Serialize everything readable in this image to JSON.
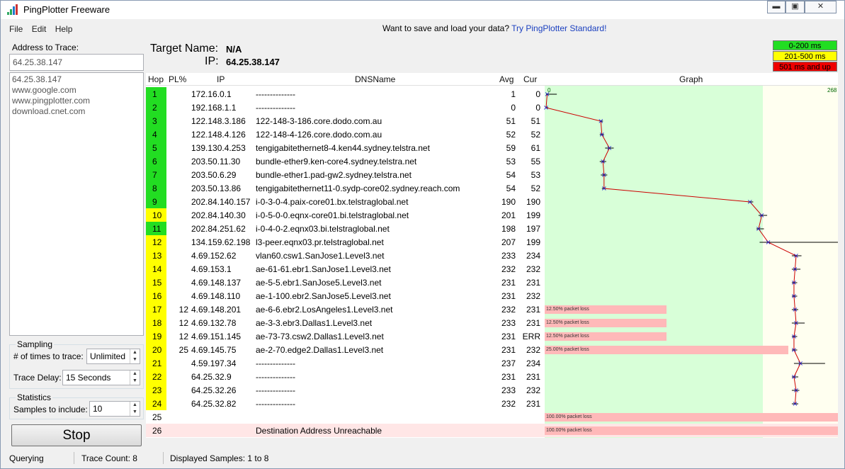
{
  "window": {
    "title": "PingPlotter Freeware"
  },
  "menu": [
    "File",
    "Edit",
    "Help"
  ],
  "promo": {
    "text": "Want to save and load your data?",
    "link": "Try PingPlotter Standard!"
  },
  "address": {
    "label": "Address to Trace:",
    "value": "64.25.38.147",
    "history": [
      "64.25.38.147",
      "www.google.com",
      "www.pingplotter.com",
      "download.cnet.com"
    ]
  },
  "sampling": {
    "title": "Sampling",
    "times_label": "# of times to trace:",
    "times_value": "Unlimited",
    "delay_label": "Trace Delay:",
    "delay_value": "15 Seconds"
  },
  "statistics": {
    "title": "Statistics",
    "samples_label": "Samples to include:",
    "samples_value": "10"
  },
  "stop_button": "Stop",
  "target": {
    "name_label": "Target Name:",
    "name_value": "N/A",
    "ip_label": "IP:",
    "ip_value": "64.25.38.147"
  },
  "legend": [
    {
      "label": "0-200 ms",
      "color": "#22dd22"
    },
    {
      "label": "201-500 ms",
      "color": "#ffff00"
    },
    {
      "label": "501 ms and up",
      "color": "#ee0000"
    }
  ],
  "columns": {
    "hop": "Hop",
    "pl": "PL%",
    "ip": "IP",
    "dns": "DNSName",
    "avg": "Avg",
    "cur": "Cur",
    "graph": "Graph"
  },
  "graph_scale": {
    "min_label": "0",
    "max_label": "268",
    "max": 268
  },
  "hops": [
    {
      "hop": "1",
      "pl": "",
      "ip": "172.16.0.1",
      "dns": "--------------",
      "avg": "1",
      "cur": "0",
      "color": "green",
      "err": [
        0,
        10
      ]
    },
    {
      "hop": "2",
      "pl": "",
      "ip": "192.168.1.1",
      "dns": "--------------",
      "avg": "0",
      "cur": "0",
      "color": "green",
      "err": [
        0,
        2
      ]
    },
    {
      "hop": "3",
      "pl": "",
      "ip": "122.148.3.186",
      "dns": "122-148-3-186.core.dodo.com.au",
      "avg": "51",
      "cur": "51",
      "color": "green",
      "err": [
        50,
        53
      ]
    },
    {
      "hop": "4",
      "pl": "",
      "ip": "122.148.4.126",
      "dns": "122-148-4-126.core.dodo.com.au",
      "avg": "52",
      "cur": "52",
      "color": "green",
      "err": [
        50,
        54
      ]
    },
    {
      "hop": "5",
      "pl": "",
      "ip": "139.130.4.253",
      "dns": "tengigabitethernet8-4.ken44.sydney.telstra.net",
      "avg": "59",
      "cur": "61",
      "color": "green",
      "err": [
        55,
        63
      ]
    },
    {
      "hop": "6",
      "pl": "",
      "ip": "203.50.11.30",
      "dns": "bundle-ether9.ken-core4.sydney.telstra.net",
      "avg": "53",
      "cur": "55",
      "color": "green",
      "err": [
        50,
        56
      ]
    },
    {
      "hop": "7",
      "pl": "",
      "ip": "203.50.6.29",
      "dns": "bundle-ether1.pad-gw2.sydney.telstra.net",
      "avg": "54",
      "cur": "53",
      "color": "green",
      "err": [
        51,
        57
      ]
    },
    {
      "hop": "8",
      "pl": "",
      "ip": "203.50.13.86",
      "dns": "tengigabitethernet11-0.sydp-core02.sydney.reach.com",
      "avg": "54",
      "cur": "52",
      "color": "green",
      "err": [
        52,
        56
      ]
    },
    {
      "hop": "9",
      "pl": "",
      "ip": "202.84.140.157",
      "dns": "i-0-3-0-4.paix-core01.bx.telstraglobal.net",
      "avg": "190",
      "cur": "190",
      "color": "green",
      "err": [
        188,
        193
      ]
    },
    {
      "hop": "10",
      "pl": "",
      "ip": "202.84.140.30",
      "dns": "i-0-5-0-0.eqnx-core01.bi.telstraglobal.net",
      "avg": "201",
      "cur": "199",
      "color": "yellow",
      "err": [
        198,
        206
      ]
    },
    {
      "hop": "11",
      "pl": "",
      "ip": "202.84.251.62",
      "dns": "i-0-4-0-2.eqnx03.bi.telstraglobal.net",
      "avg": "198",
      "cur": "197",
      "color": "green",
      "err": [
        196,
        203
      ]
    },
    {
      "hop": "12",
      "pl": "",
      "ip": "134.159.62.198",
      "dns": "l3-peer.eqnx03.pr.telstraglobal.net",
      "avg": "207",
      "cur": "199",
      "color": "yellow",
      "err": [
        199,
        290
      ]
    },
    {
      "hop": "13",
      "pl": "",
      "ip": "4.69.152.62",
      "dns": "vlan60.csw1.SanJose1.Level3.net",
      "avg": "233",
      "cur": "234",
      "color": "yellow",
      "err": [
        229,
        238
      ]
    },
    {
      "hop": "14",
      "pl": "",
      "ip": "4.69.153.1",
      "dns": "ae-61-61.ebr1.SanJose1.Level3.net",
      "avg": "232",
      "cur": "232",
      "color": "yellow",
      "err": [
        229,
        237
      ]
    },
    {
      "hop": "15",
      "pl": "",
      "ip": "4.69.148.137",
      "dns": "ae-5-5.ebr1.SanJose5.Level3.net",
      "avg": "231",
      "cur": "231",
      "color": "yellow",
      "err": [
        229,
        234
      ]
    },
    {
      "hop": "16",
      "pl": "",
      "ip": "4.69.148.110",
      "dns": "ae-1-100.ebr2.SanJose5.Level3.net",
      "avg": "231",
      "cur": "232",
      "color": "yellow",
      "err": [
        229,
        234
      ]
    },
    {
      "hop": "17",
      "pl": "12",
      "ip": "4.69.148.201",
      "dns": "ae-6-6.ebr2.LosAngeles1.Level3.net",
      "avg": "232",
      "cur": "231",
      "color": "yellow",
      "loss": "12.50% packet loss",
      "loss_frac": 0.415,
      "err": [
        229,
        235
      ]
    },
    {
      "hop": "18",
      "pl": "12",
      "ip": "4.69.132.78",
      "dns": "ae-3-3.ebr3.Dallas1.Level3.net",
      "avg": "233",
      "cur": "231",
      "color": "yellow",
      "loss": "12.50% packet loss",
      "loss_frac": 0.415,
      "err": [
        229,
        241
      ]
    },
    {
      "hop": "19",
      "pl": "12",
      "ip": "4.69.151.145",
      "dns": "ae-73-73.csw2.Dallas1.Level3.net",
      "avg": "231",
      "cur": "ERR",
      "color": "yellow",
      "loss": "12.50% packet loss",
      "loss_frac": 0.415,
      "err": [
        229,
        234
      ]
    },
    {
      "hop": "20",
      "pl": "25",
      "ip": "4.69.145.75",
      "dns": "ae-2-70.edge2.Dallas1.Level3.net",
      "avg": "231",
      "cur": "232",
      "color": "yellow",
      "loss": "25.00% packet loss",
      "loss_frac": 0.83,
      "err": [
        229,
        234
      ]
    },
    {
      "hop": "21",
      "pl": "",
      "ip": "4.59.197.34",
      "dns": "--------------",
      "avg": "237",
      "cur": "234",
      "color": "yellow",
      "err": [
        231,
        260
      ]
    },
    {
      "hop": "22",
      "pl": "",
      "ip": "64.25.32.9",
      "dns": "--------------",
      "avg": "231",
      "cur": "231",
      "color": "yellow",
      "err": [
        229,
        235
      ]
    },
    {
      "hop": "23",
      "pl": "",
      "ip": "64.25.32.26",
      "dns": "--------------",
      "avg": "233",
      "cur": "232",
      "color": "yellow",
      "err": [
        229,
        236
      ]
    },
    {
      "hop": "24",
      "pl": "",
      "ip": "64.25.32.82",
      "dns": "--------------",
      "avg": "232",
      "cur": "231",
      "color": "yellow",
      "err": [
        229,
        235
      ]
    },
    {
      "hop": "25",
      "pl": "",
      "ip": "",
      "dns": "",
      "avg": "",
      "cur": "",
      "color": "none",
      "loss": "100.00% packet loss",
      "loss_frac": 1.0
    },
    {
      "hop": "26",
      "pl": "",
      "ip": "",
      "dns": "Destination Address Unreachable",
      "avg": "",
      "cur": "",
      "color": "none",
      "loss": "100.00% packet loss",
      "loss_frac": 1.0,
      "unreachable": true
    }
  ],
  "status": {
    "state": "Querying",
    "trace_count": "Trace Count: 8",
    "displayed": "Displayed Samples: 1 to 8"
  }
}
